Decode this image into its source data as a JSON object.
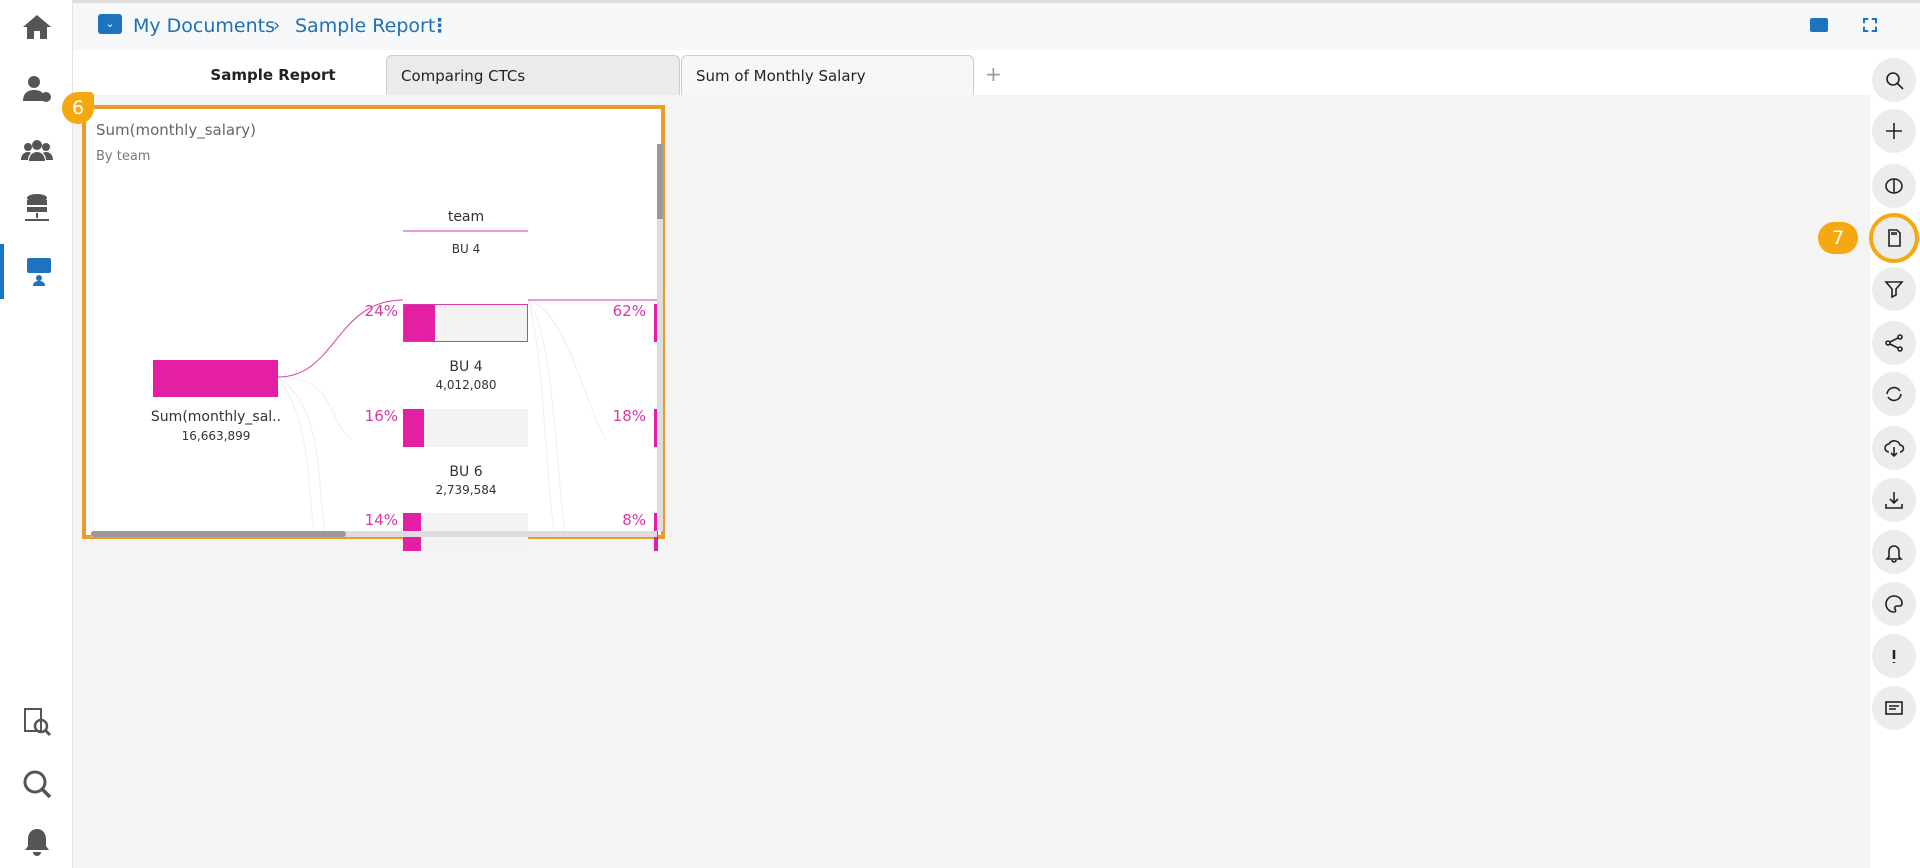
{
  "breadcrumb": {
    "folder": "My Documents",
    "report": "Sample Report"
  },
  "tabs": [
    {
      "label": "Sample Report",
      "active": true
    },
    {
      "label": "Comparing CTCs"
    },
    {
      "label": "Sum of Monthly Salary"
    }
  ],
  "add_tab": "+",
  "annotations": {
    "chart": "6",
    "toolbar_button": "7"
  },
  "colors": {
    "accent": "#e41fa4",
    "highlight": "#ec9a28",
    "brand": "#1e73be"
  },
  "chart_data": {
    "type": "decomposition-tree",
    "title": "Sum(monthly_salary)",
    "subtitle": "By team",
    "root": {
      "label": "Sum(monthly_sal..",
      "value": "16,663,899"
    },
    "level_header": "team",
    "level_selected": "BU 4",
    "nodes": [
      {
        "label": "BU 4",
        "value": "4,012,080",
        "pct": "24%",
        "share": 0.24,
        "selected": true
      },
      {
        "label": "BU 6",
        "value": "2,739,584",
        "pct": "16%",
        "share": 0.16
      },
      {
        "label": "",
        "value": "",
        "pct": "14%",
        "share": 0.14
      }
    ],
    "next_level_pcts": [
      "62%",
      "18%",
      "8%"
    ]
  },
  "right_toolbar": [
    "search-icon",
    "plus-icon",
    "brain-icon",
    "sd-card-icon",
    "filter-icon",
    "share-icon",
    "refresh-icon",
    "cloud-download-icon",
    "download-icon",
    "bell-icon",
    "palette-icon",
    "exclamation-icon",
    "message-icon"
  ]
}
